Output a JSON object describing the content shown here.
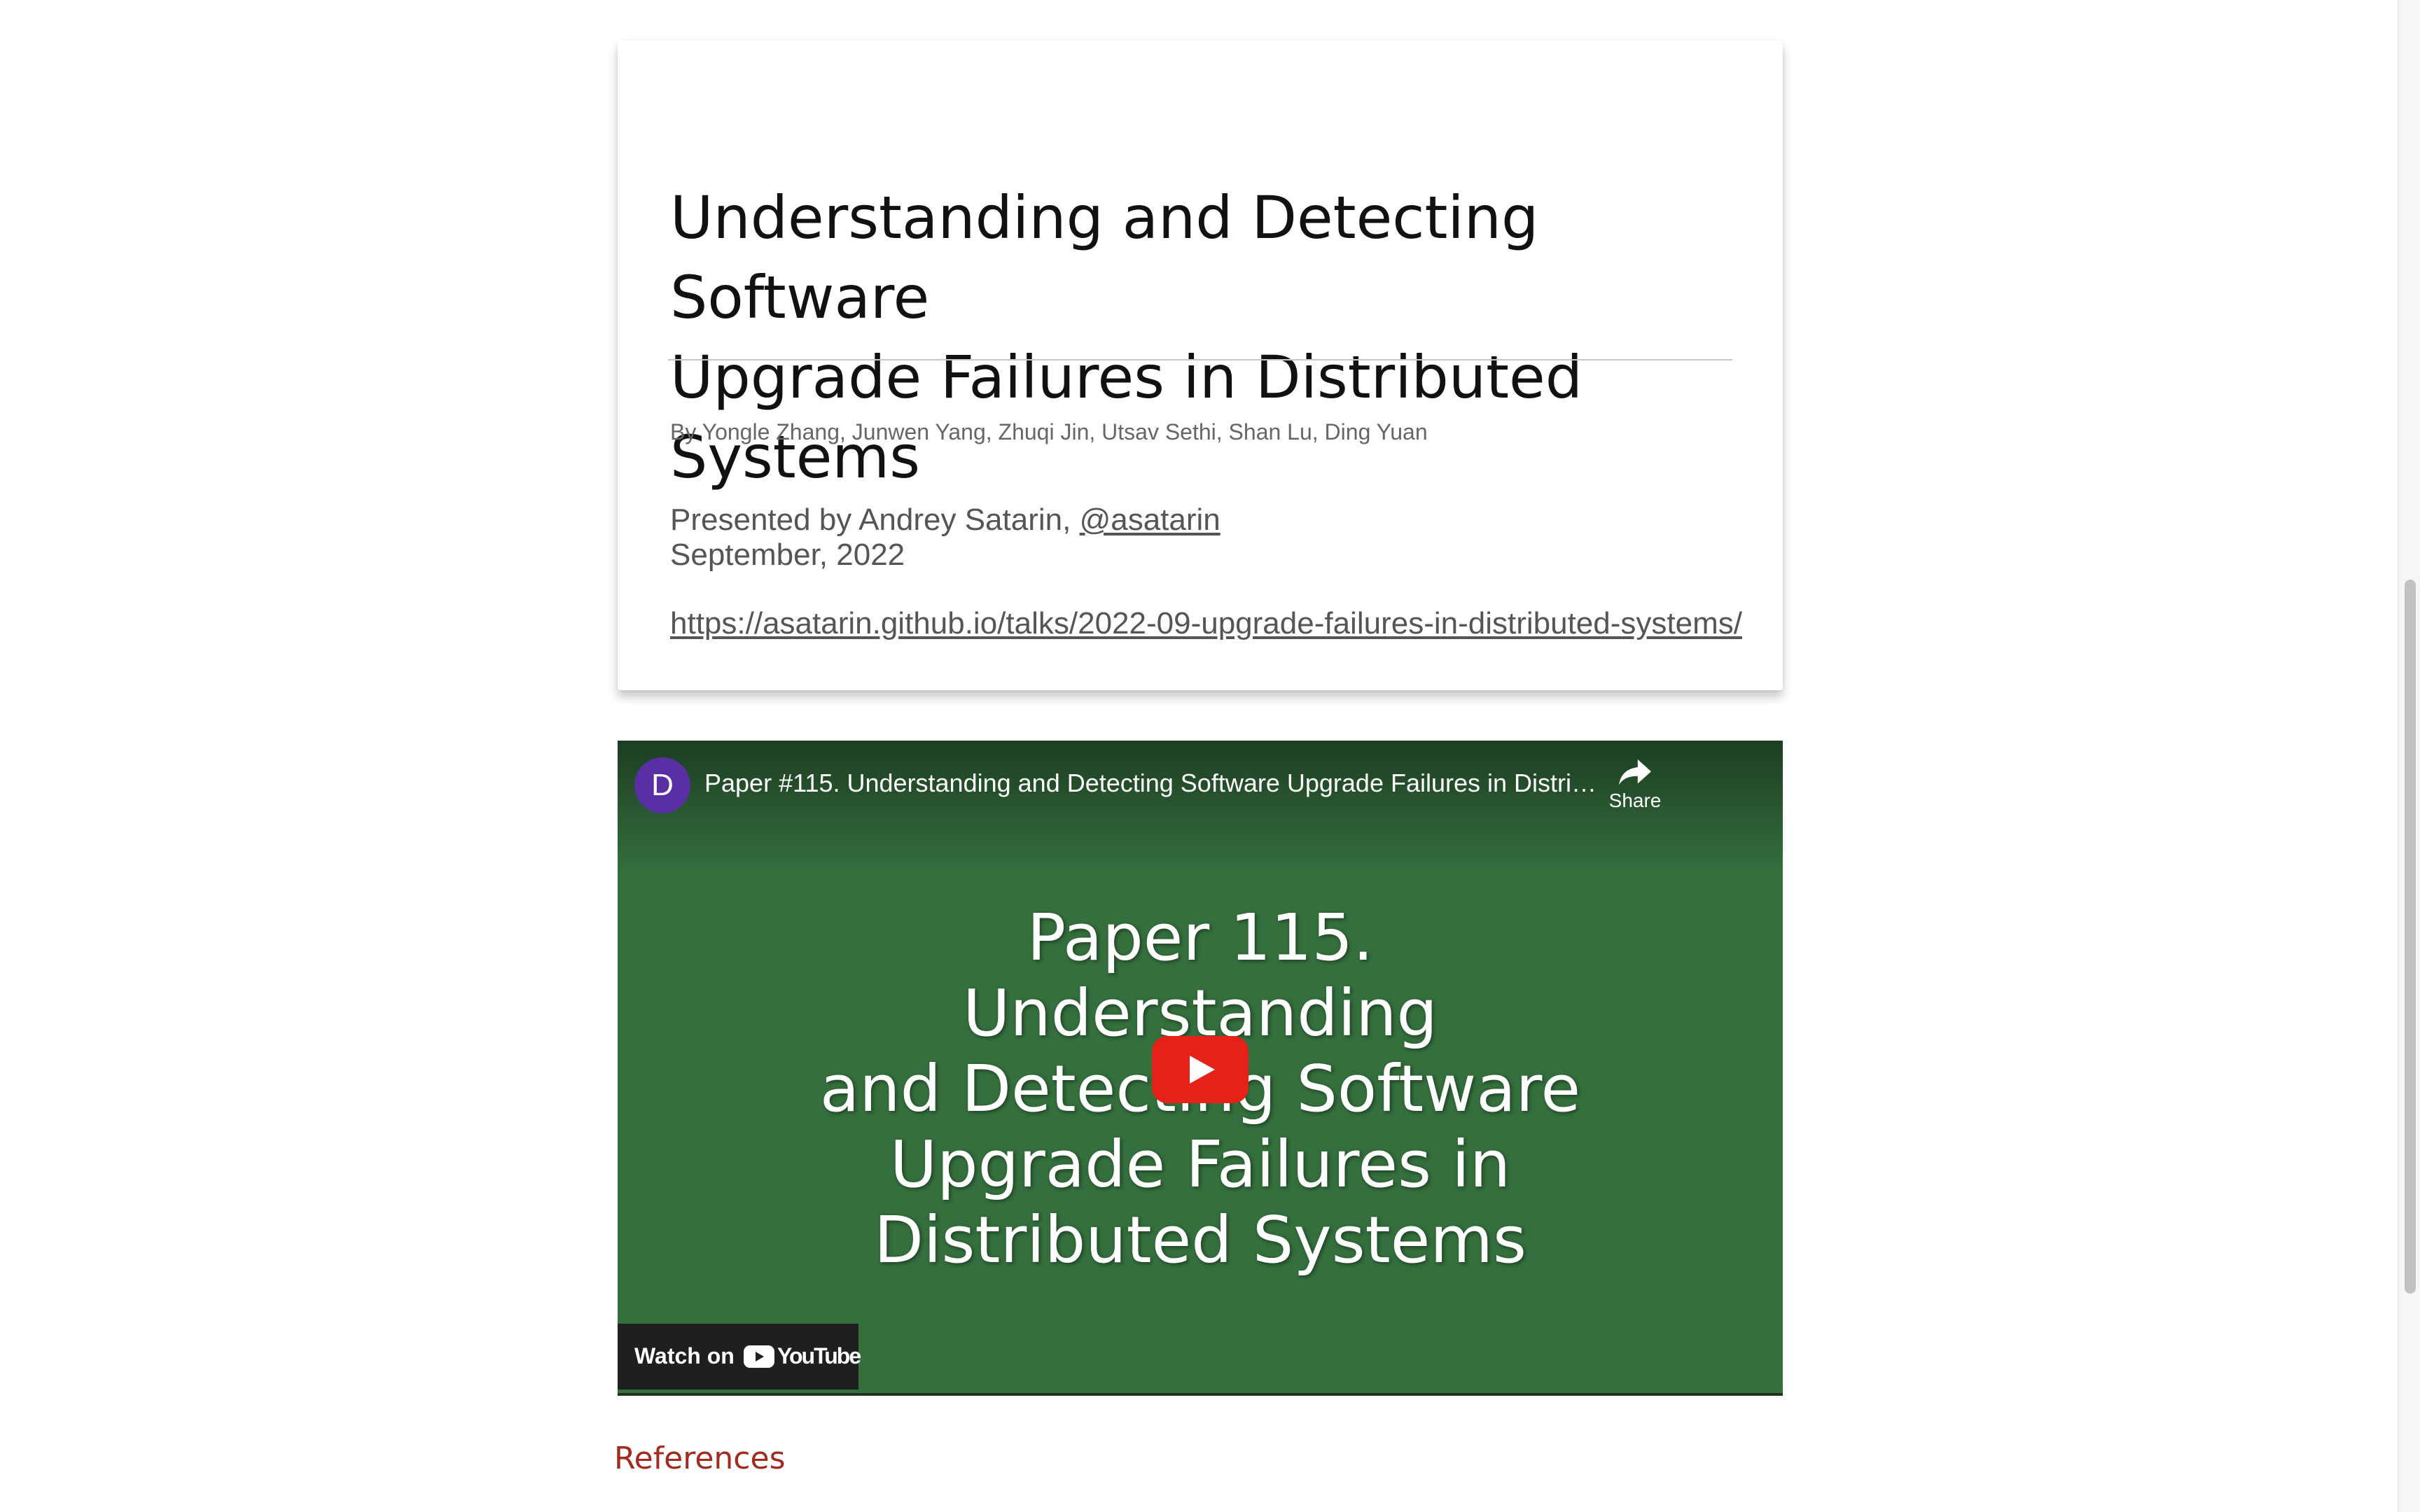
{
  "slide": {
    "title_line1": "Understanding and Detecting Software",
    "title_line2": "Upgrade Failures in Distributed Systems",
    "authors": "By Yongle Zhang, Junwen Yang, Zhuqi Jin, Utsav Sethi, Shan Lu, Ding Yuan",
    "presented_by_prefix": "Presented by Andrey Satarin, ",
    "presenter_handle": "@asatarin",
    "date": "September, 2022",
    "talk_url": "https://asatarin.github.io/talks/2022-09-upgrade-failures-in-distributed-systems/"
  },
  "video": {
    "channel_initial": "D",
    "title": "Paper #115. Understanding and Detecting Software Upgrade Failures in Distributed S...",
    "share_label": "Share",
    "thumbnail_lines": [
      "Paper 115. Understanding",
      "and Detecting Software",
      "Upgrade Failures in",
      "Distributed Systems"
    ],
    "watch_on_label": "Watch on",
    "youtube_wordmark": "YouTube",
    "icons": {
      "share": "share-arrow-icon",
      "play": "play-icon",
      "youtube": "youtube-logo-icon"
    },
    "colors": {
      "background": "#346f3d",
      "avatar": "#5a2fa6",
      "play_button": "#e62117"
    }
  },
  "references_heading": "References",
  "accent_color": "#a32a1f"
}
